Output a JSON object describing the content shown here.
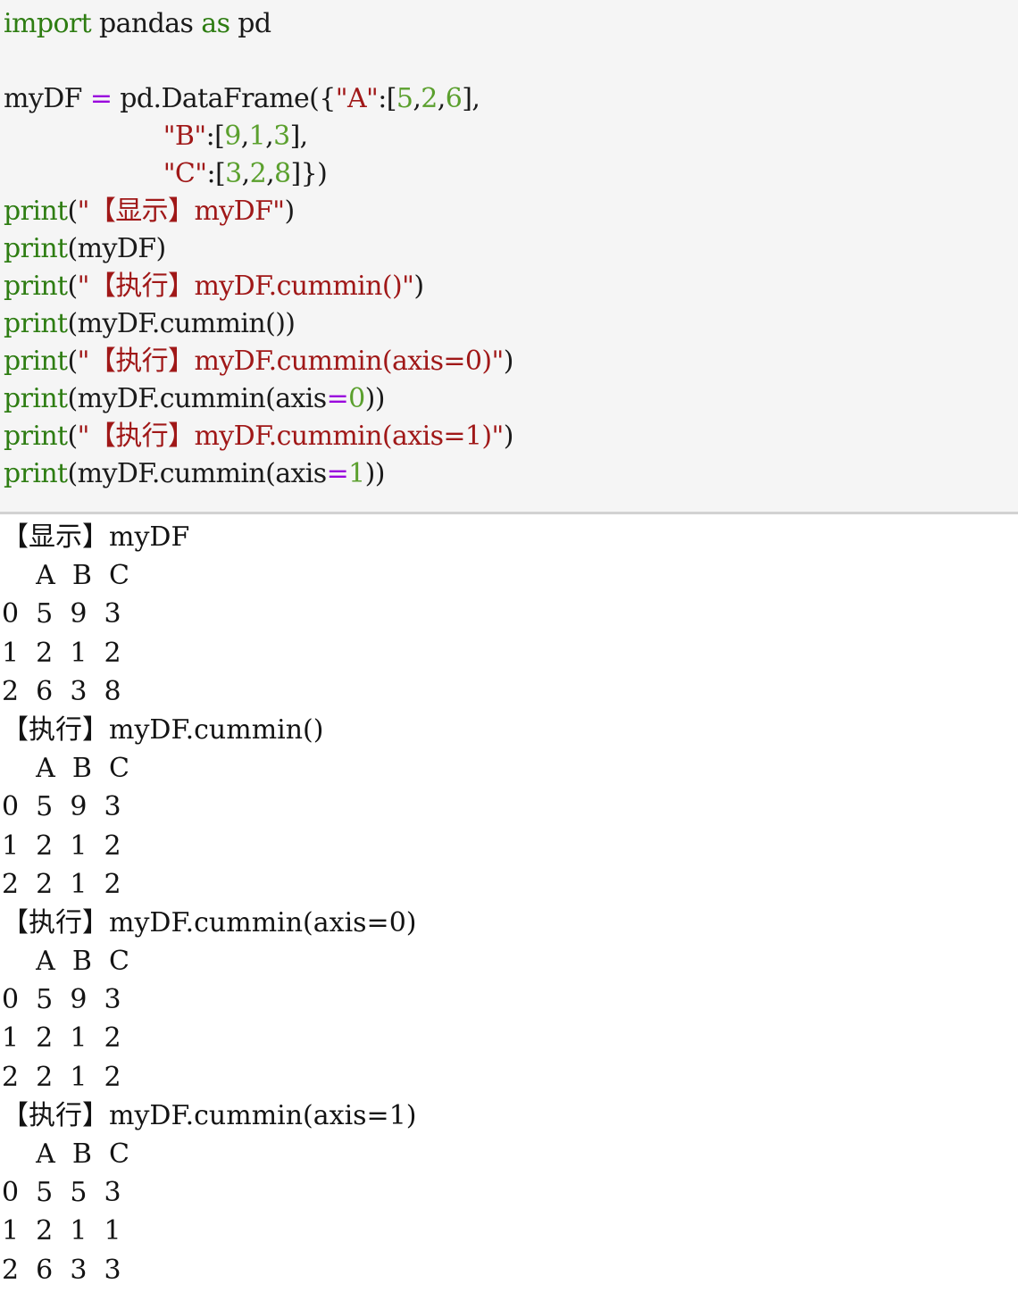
{
  "code": {
    "lines": [
      [
        {
          "t": "import",
          "c": "kw"
        },
        {
          "t": " pandas ",
          "c": "plain"
        },
        {
          "t": "as",
          "c": "kw"
        },
        {
          "t": " pd",
          "c": "plain"
        }
      ],
      [
        {
          "t": "",
          "c": "plain"
        }
      ],
      [
        {
          "t": "myDF ",
          "c": "plain"
        },
        {
          "t": "=",
          "c": "op"
        },
        {
          "t": " pd.DataFrame({",
          "c": "plain"
        },
        {
          "t": "\"A\"",
          "c": "str"
        },
        {
          "t": ":[",
          "c": "plain"
        },
        {
          "t": "5",
          "c": "num"
        },
        {
          "t": ",",
          "c": "plain"
        },
        {
          "t": "2",
          "c": "num"
        },
        {
          "t": ",",
          "c": "plain"
        },
        {
          "t": "6",
          "c": "num"
        },
        {
          "t": "],",
          "c": "plain"
        }
      ],
      [
        {
          "t": "                    ",
          "c": "plain"
        },
        {
          "t": "\"B\"",
          "c": "str"
        },
        {
          "t": ":[",
          "c": "plain"
        },
        {
          "t": "9",
          "c": "num"
        },
        {
          "t": ",",
          "c": "plain"
        },
        {
          "t": "1",
          "c": "num"
        },
        {
          "t": ",",
          "c": "plain"
        },
        {
          "t": "3",
          "c": "num"
        },
        {
          "t": "],",
          "c": "plain"
        }
      ],
      [
        {
          "t": "                    ",
          "c": "plain"
        },
        {
          "t": "\"C\"",
          "c": "str"
        },
        {
          "t": ":[",
          "c": "plain"
        },
        {
          "t": "3",
          "c": "num"
        },
        {
          "t": ",",
          "c": "plain"
        },
        {
          "t": "2",
          "c": "num"
        },
        {
          "t": ",",
          "c": "plain"
        },
        {
          "t": "8",
          "c": "num"
        },
        {
          "t": "]})",
          "c": "plain"
        }
      ],
      [
        {
          "t": "print",
          "c": "fn"
        },
        {
          "t": "(",
          "c": "plain"
        },
        {
          "t": "\"【显示】myDF\"",
          "c": "str"
        },
        {
          "t": ")",
          "c": "plain"
        }
      ],
      [
        {
          "t": "print",
          "c": "fn"
        },
        {
          "t": "(myDF)",
          "c": "plain"
        }
      ],
      [
        {
          "t": "print",
          "c": "fn"
        },
        {
          "t": "(",
          "c": "plain"
        },
        {
          "t": "\"【执行】myDF.cummin()\"",
          "c": "str"
        },
        {
          "t": ")",
          "c": "plain"
        }
      ],
      [
        {
          "t": "print",
          "c": "fn"
        },
        {
          "t": "(myDF.cummin())",
          "c": "plain"
        }
      ],
      [
        {
          "t": "print",
          "c": "fn"
        },
        {
          "t": "(",
          "c": "plain"
        },
        {
          "t": "\"【执行】myDF.cummin(axis=0)\"",
          "c": "str"
        },
        {
          "t": ")",
          "c": "plain"
        }
      ],
      [
        {
          "t": "print",
          "c": "fn"
        },
        {
          "t": "(myDF.cummin(axis",
          "c": "plain"
        },
        {
          "t": "=",
          "c": "op"
        },
        {
          "t": "0",
          "c": "num"
        },
        {
          "t": "))",
          "c": "plain"
        }
      ],
      [
        {
          "t": "print",
          "c": "fn"
        },
        {
          "t": "(",
          "c": "plain"
        },
        {
          "t": "\"【执行】myDF.cummin(axis=1)\"",
          "c": "str"
        },
        {
          "t": ")",
          "c": "plain"
        }
      ],
      [
        {
          "t": "print",
          "c": "fn"
        },
        {
          "t": "(myDF.cummin(axis",
          "c": "plain"
        },
        {
          "t": "=",
          "c": "op"
        },
        {
          "t": "1",
          "c": "num"
        },
        {
          "t": "))",
          "c": "plain"
        }
      ]
    ]
  },
  "output": {
    "sections": [
      {
        "heading": "【显示】myDF",
        "header_row": "    A  B  C",
        "rows": [
          "0  5  9  3",
          "1  2  1  2",
          "2  6  3  8"
        ]
      },
      {
        "heading": "【执行】myDF.cummin()",
        "header_row": "    A  B  C",
        "rows": [
          "0  5  9  3",
          "1  2  1  2",
          "2  2  1  2"
        ]
      },
      {
        "heading": "【执行】myDF.cummin(axis=0)",
        "header_row": "    A  B  C",
        "rows": [
          "0  5  9  3",
          "1  2  1  2",
          "2  2  1  2"
        ]
      },
      {
        "heading": "【执行】myDF.cummin(axis=1)",
        "header_row": "    A  B  C",
        "rows": [
          "0  5  5  3",
          "1  2  1  1",
          "2  6  3  3"
        ]
      }
    ]
  },
  "colors": {
    "keyword": "#2e7d12",
    "string": "#a01818",
    "number": "#5ba02e",
    "operator": "#9900dd",
    "plain": "#1a1a1a",
    "code_background": "#f5f5f5",
    "output_background": "#ffffff",
    "divider": "#d2d2d2"
  }
}
